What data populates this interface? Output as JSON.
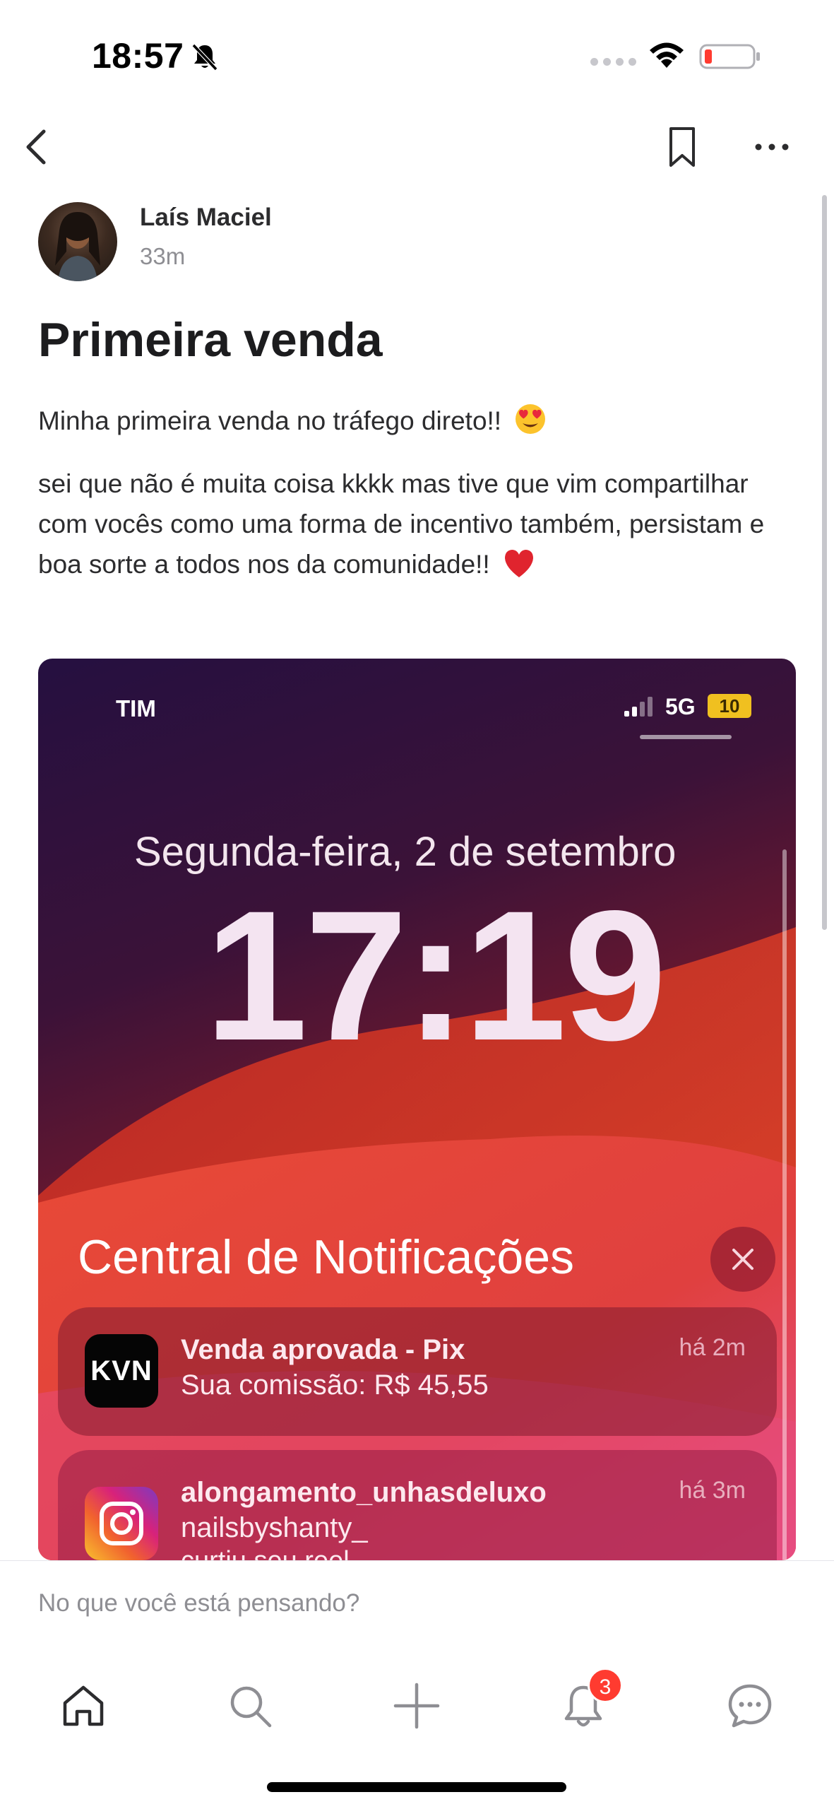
{
  "status_bar": {
    "time": "18:57"
  },
  "post": {
    "author": "Laís Maciel",
    "time_ago": "33m",
    "title": "Primeira venda",
    "line1": "Minha primeira venda no tráfego direto!!",
    "body": "sei que não é muita coisa kkkk mas tive que vim compartilhar com vocês como uma forma de incentivo também, persistam e boa sorte a todos nos da comunidade!!"
  },
  "image": {
    "carrier": "TIM",
    "network": "5G",
    "battery": "10",
    "date": "Segunda-feira, 2 de setembro",
    "clock": "17:19",
    "nc_title": "Central de Notificações",
    "notifications": [
      {
        "icon": "kvn-app-icon",
        "app_label": "KVN",
        "title": "Venda aprovada - Pix",
        "subtitle": "Sua comissão: R$ 45,55",
        "time": "há 2m"
      },
      {
        "icon": "instagram-icon",
        "title": "alongamento_unhasdeluxo",
        "subtitle": "nailsbyshanty_",
        "subtitle2": "curtiu seu reel",
        "time": "há 3m"
      }
    ]
  },
  "composer": {
    "placeholder": "No que você está pensando?"
  },
  "tabbar": {
    "notifications_badge": "3"
  }
}
